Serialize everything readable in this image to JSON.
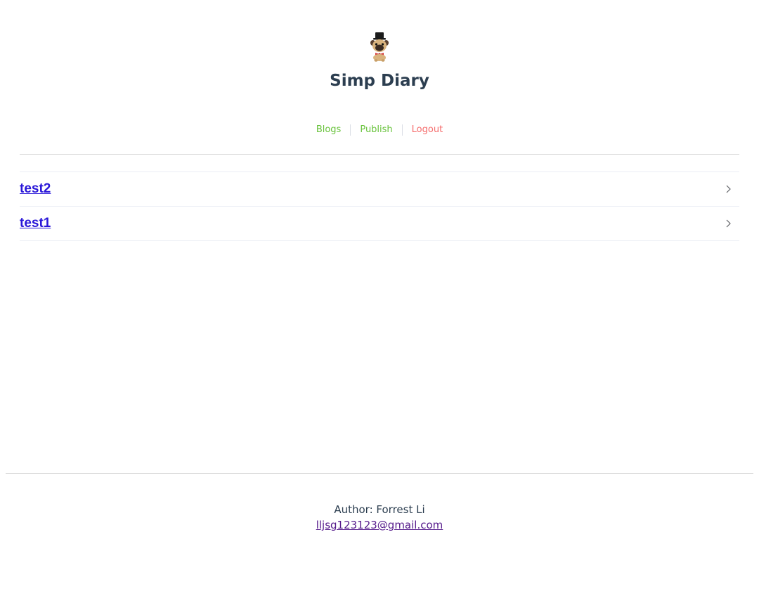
{
  "header": {
    "logo_icon": "pug-with-top-hat-icon",
    "title": "Simp Diary"
  },
  "nav": {
    "items": [
      {
        "label": "Blogs",
        "color": "#67c23a"
      },
      {
        "label": "Publish",
        "color": "#67c23a"
      },
      {
        "label": "Logout",
        "color": "#f56c6c"
      }
    ]
  },
  "blogs": {
    "items": [
      {
        "title": "test2"
      },
      {
        "title": "test1"
      }
    ]
  },
  "footer": {
    "author": "Author: Forrest Li",
    "email": "lljsg123123@gmail.com"
  }
}
